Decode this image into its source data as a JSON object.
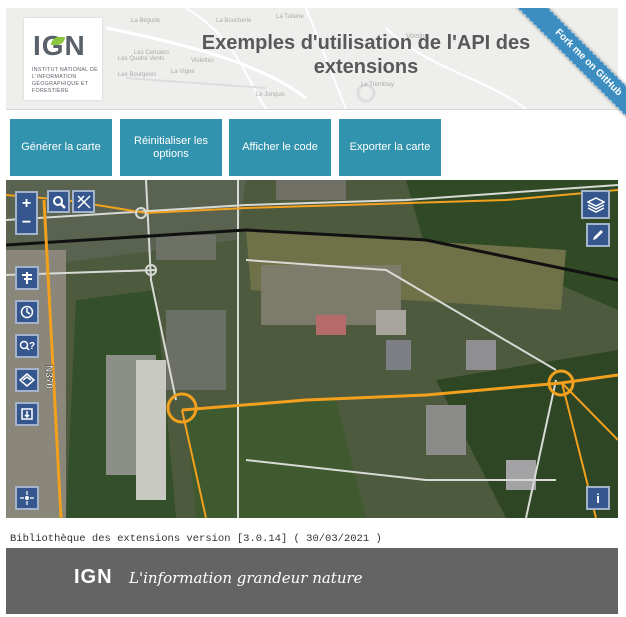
{
  "header": {
    "title": "Exemples d'utilisation de l'API des extensions",
    "logo_text": "IGN",
    "logo_subtitle": "INSTITUT NATIONAL DE L'INFORMATION GÉOGRAPHIQUE ET FORESTIÈRE",
    "ribbon": "Fork me on GitHub",
    "map_labels": [
      "La Bégude",
      "La Boucherie",
      "La Tuilerie",
      "Voisins",
      "Les Quatre Vents",
      "Les Cerisiers",
      "Violettes",
      "La Vigne",
      "Les Bourgeois",
      "Le Tremblay",
      "Le Jonquis"
    ]
  },
  "buttons": [
    {
      "label": "Générer la carte"
    },
    {
      "label": "Réinitialiser les options"
    },
    {
      "label": "Afficher le code"
    },
    {
      "label": "Exporter la carte"
    }
  ],
  "map": {
    "road_label": "N370",
    "zoom_in": "+",
    "zoom_out": "−",
    "info": "i",
    "controls": [
      "search-icon",
      "drawing-icon",
      "layers-icon",
      "pencil-icon",
      "route-icon",
      "isochrone-icon",
      "reverse-geocode-icon",
      "elevation-icon",
      "layer-import-icon",
      "mouse-position-icon",
      "info-icon"
    ]
  },
  "footer": {
    "version_text": "Bibliothèque des extensions version [3.0.14] ( 30/03/2021 )",
    "logo": "IGN",
    "tagline": "L'information grandeur nature"
  },
  "colors": {
    "button": "#3193ad",
    "control": "#36578e",
    "footer": "#646464",
    "ribbon": "#3c8ec1",
    "road": "#f2a01e"
  }
}
